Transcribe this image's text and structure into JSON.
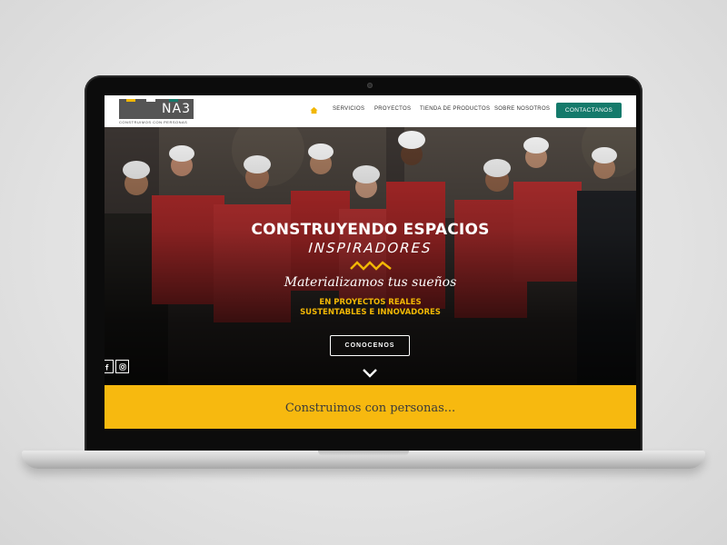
{
  "logo": {
    "text": "NA3",
    "tagline": "CONSTRUIMOS CON PERSONAS",
    "strip_colors": [
      "#f2b705",
      "#147a6b"
    ]
  },
  "nav": {
    "items": [
      {
        "label": "SERVICIOS"
      },
      {
        "label": "PROYECTOS"
      },
      {
        "label": "TIENDA DE PRODUCTOS"
      },
      {
        "label": "SOBRE NOSOTROS"
      }
    ],
    "cta_label": "CONTACTANOS",
    "home_icon": "home-icon"
  },
  "hero": {
    "title": "CONSTRUYENDO ESPACIOS",
    "subtitle": "INSPIRADORES",
    "tagline": "Materializamos tus sueños",
    "highlight_line1": "EN PROYECTOS REALES",
    "highlight_line2": "SUSTENTABLES E INNOVADORES",
    "button_label": "CONOCENOS",
    "social_icons": [
      "facebook-icon",
      "instagram-icon"
    ]
  },
  "band": {
    "text": "Construimos con personas..."
  },
  "colors": {
    "accent_yellow": "#f2b705",
    "cta_green": "#147a6b"
  }
}
